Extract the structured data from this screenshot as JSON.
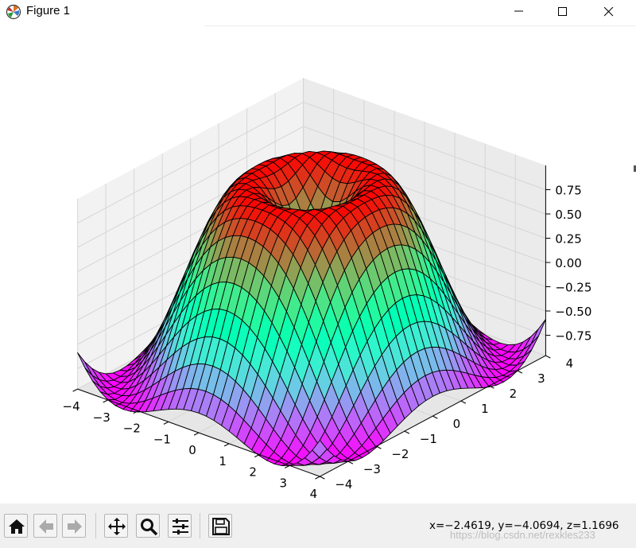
{
  "window": {
    "title": "Figure 1",
    "controls": {
      "minimize": "minimize",
      "maximize": "maximize",
      "close": "close"
    }
  },
  "toolbar": {
    "buttons": [
      {
        "name": "home-button",
        "icon": "home-icon",
        "tooltip": "Reset original view"
      },
      {
        "name": "back-button",
        "icon": "arrow-left-icon",
        "tooltip": "Back"
      },
      {
        "name": "forward-button",
        "icon": "arrow-right-icon",
        "tooltip": "Forward"
      },
      {
        "name": "pan-button",
        "icon": "move-icon",
        "tooltip": "Pan"
      },
      {
        "name": "zoom-button",
        "icon": "magnifier-icon",
        "tooltip": "Zoom"
      },
      {
        "name": "configure-button",
        "icon": "sliders-icon",
        "tooltip": "Configure subplots"
      },
      {
        "name": "save-button",
        "icon": "floppy-disk-icon",
        "tooltip": "Save the figure"
      }
    ],
    "coordinates": "x=−2.4619, y=−4.0694, z=1.1696"
  },
  "watermark": "https://blog.csdn.net/rexkles233",
  "chart_data": {
    "type": "surface",
    "function": "z = sin(sqrt(x^2 + y^2))",
    "colormap": "rainbow",
    "x": {
      "range": [
        -4,
        4
      ],
      "ticks": [
        "−4",
        "−3",
        "−2",
        "−1",
        "0",
        "1",
        "2",
        "3",
        "4"
      ]
    },
    "y": {
      "range": [
        -4,
        4
      ],
      "ticks": [
        "−4",
        "−3",
        "−2",
        "−1",
        "0",
        "1",
        "2",
        "3",
        "4"
      ]
    },
    "z": {
      "range": [
        -0.96,
        1.0
      ],
      "ticks": [
        "−0.75",
        "−0.50",
        "−0.25",
        "0.00",
        "0.25",
        "0.50",
        "0.75"
      ]
    },
    "grid": true,
    "title": "",
    "xlabel": "",
    "ylabel": "",
    "zlabel": ""
  }
}
